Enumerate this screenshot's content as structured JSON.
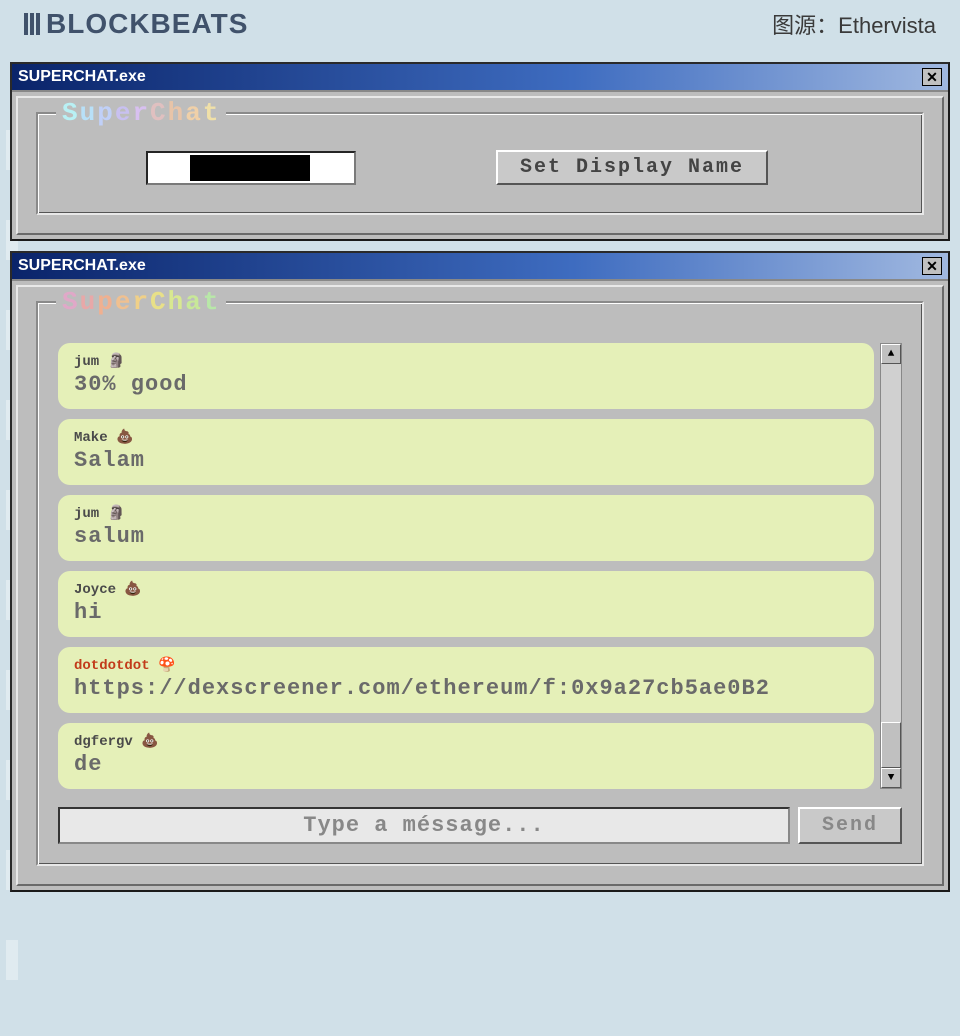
{
  "header": {
    "brand": "BLOCKBEATS",
    "credit_label": "图源：",
    "credit_source": "Ethervista"
  },
  "window1": {
    "title": "SUPERCHAT.exe",
    "legend": "SuperChat",
    "set_name_button": "Set Display Name"
  },
  "window2": {
    "title": "SUPERCHAT.exe",
    "legend": "SuperChat",
    "messages": [
      {
        "user": "jum",
        "emoji": "🗿",
        "text": "30% good",
        "special": false
      },
      {
        "user": "Make",
        "emoji": "💩",
        "text": "Salam",
        "special": false
      },
      {
        "user": "jum",
        "emoji": "🗿",
        "text": "salum",
        "special": false
      },
      {
        "user": "Joyce",
        "emoji": "💩",
        "text": "hi",
        "special": false
      },
      {
        "user": "dotdotdot",
        "emoji": "🍄",
        "text": "https://dexscreener.com/ethereum/f:0x9a27cb5ae0B2",
        "special": true
      },
      {
        "user": "dgfergv",
        "emoji": "💩",
        "text": "de",
        "special": false
      }
    ],
    "compose_placeholder": "Type a méssage...",
    "send_button": "Send"
  }
}
